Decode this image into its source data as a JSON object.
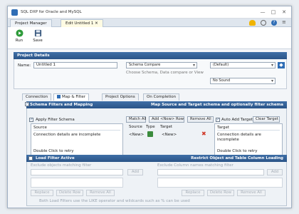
{
  "window": {
    "title": "SQL DXP for Oracle and MySQL",
    "controls": [
      "—",
      "□",
      "✕"
    ]
  },
  "doc_tabs": [
    {
      "label": "Project Manager"
    },
    {
      "label": "Edit Untitled 1 ✕"
    }
  ],
  "ribbon": {
    "run_label": "Run",
    "save_label": "Save"
  },
  "project_details": {
    "header": "Project Details",
    "name_label": "Name:",
    "name_value": "Untitled 1",
    "mode_value": "Schema Compare",
    "mode_hint": "Choose Schema, Data compare or View",
    "profile_value": "(Default)",
    "sound_value": "No Sound"
  },
  "tabs": [
    "Connection",
    "Map & Filter",
    "Project Options",
    "On Completion"
  ],
  "mapping": {
    "header_left": "Schema Filters and Mapping",
    "header_right": "Map Source and Target schema and optionally filter schema",
    "apply_filter_label": "Apply Filter Schema",
    "match_all": "Match All",
    "add_new_row": "Add <New> Row",
    "remove_all": "Remove All",
    "auto_add_target": "Auto Add Target",
    "clear_target": "Clear Target",
    "source_header": "Source",
    "source_msg": "Connection details are incomplete",
    "source_retry": "Double Click to retry",
    "target_header": "Target",
    "target_msg": "Connection details are incomplete",
    "target_retry": "Double Click to retry",
    "col_source": "Source",
    "col_type": "Type",
    "col_target": "Target",
    "row_source": "<New>",
    "row_target": "<New>"
  },
  "load_filter": {
    "header_left": "Load Filter Active",
    "header_right": "Restrict Object and Table Column Loading",
    "exclude_objects_label": "Exclude objects matching filter",
    "exclude_columns_label": "Exclude Column names matching filter",
    "add": "Add",
    "replace": "Replace",
    "delete_row": "Delete Row",
    "remove_all": "Remove All",
    "note": "Both Load Filters use the LIKE operator and wildcards such as % can be used"
  },
  "colors": {
    "section_bar": "#2b5487",
    "run_green": "#2e9b3a",
    "accent_blue": "#2f6db5",
    "delete_red": "#d03a2a"
  }
}
